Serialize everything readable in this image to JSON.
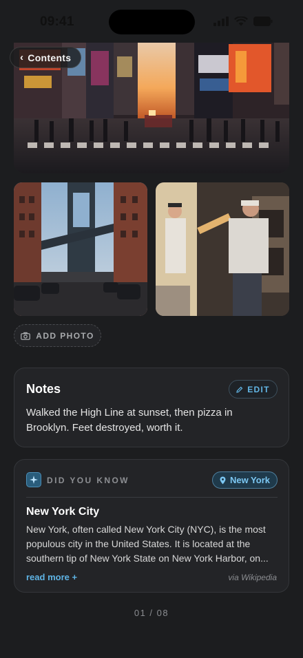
{
  "status_bar": {
    "time": "09:41",
    "icons": [
      "signal-icon",
      "wifi-icon",
      "battery-icon"
    ]
  },
  "navigation": {
    "back_label": "Contents"
  },
  "photos": [
    {
      "name": "times-square-photo",
      "description": "Times Square street at sunset"
    },
    {
      "name": "brooklyn-bridge-photo",
      "description": "Manhattan Bridge from Dumbo street"
    },
    {
      "name": "pizza-kitchen-photo",
      "description": "Pizza makers at brick oven"
    }
  ],
  "add_photo": {
    "label": "ADD PHOTO",
    "icon": "camera-icon"
  },
  "notes": {
    "title": "Notes",
    "edit_label": "EDIT",
    "edit_icon": "pencil-icon",
    "text": "Walked the High Line at sunset, then pizza in Brooklyn. Feet destroyed, worth it."
  },
  "did_you_know": {
    "label": "DID YOU KNOW",
    "icon": "sparkle-icon",
    "location": "New York",
    "location_icon": "pin-icon",
    "title": "New York City",
    "text": "New York, often called New York City (NYC), is the most populous city in the United States. It is located at the southern tip of New York State on New York Harbor, on...",
    "read_more": "read more +",
    "source": "via Wikipedia"
  },
  "pagination": {
    "text": "01 / 08"
  },
  "colors": {
    "background": "#1c1d1f",
    "card": "#232427",
    "accent": "#5eb3e4"
  }
}
